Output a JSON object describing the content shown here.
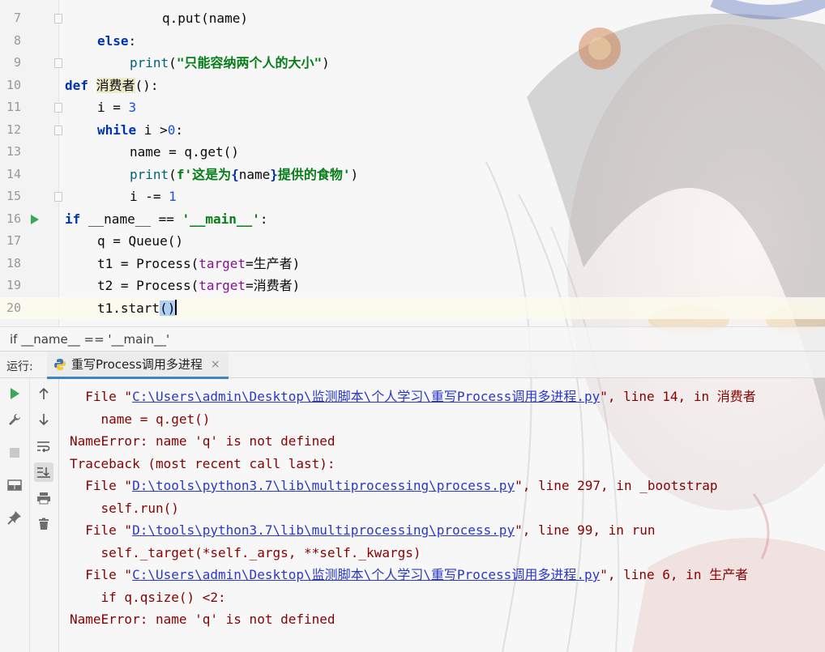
{
  "editor": {
    "lines": [
      {
        "n": "7",
        "indent": 3,
        "tokens": [
          {
            "t": "q.put(name)",
            "c": ""
          }
        ]
      },
      {
        "n": "8",
        "indent": 1,
        "tokens": [
          {
            "t": "else",
            "c": "kw"
          },
          {
            "t": ":",
            "c": ""
          }
        ]
      },
      {
        "n": "9",
        "indent": 2,
        "tokens": [
          {
            "t": "print",
            "c": "fn"
          },
          {
            "t": "(",
            "c": ""
          },
          {
            "t": "\"只能容纳两个人的大小\"",
            "c": "str"
          },
          {
            "t": ")",
            "c": ""
          }
        ]
      },
      {
        "n": "10",
        "indent": 0,
        "tokens": [
          {
            "t": "def ",
            "c": "kw"
          },
          {
            "t": "消费者",
            "c": "hl"
          },
          {
            "t": "():",
            "c": ""
          }
        ]
      },
      {
        "n": "11",
        "indent": 1,
        "tokens": [
          {
            "t": "i = ",
            "c": ""
          },
          {
            "t": "3",
            "c": "num"
          }
        ]
      },
      {
        "n": "12",
        "indent": 1,
        "tokens": [
          {
            "t": "while",
            "c": "kw"
          },
          {
            "t": " i >",
            "c": ""
          },
          {
            "t": "0",
            "c": "num"
          },
          {
            "t": ":",
            "c": ""
          }
        ]
      },
      {
        "n": "13",
        "indent": 2,
        "tokens": [
          {
            "t": "name = q.get()",
            "c": ""
          }
        ]
      },
      {
        "n": "14",
        "indent": 2,
        "tokens": [
          {
            "t": "print",
            "c": "fn"
          },
          {
            "t": "(",
            "c": ""
          },
          {
            "t": "f'这是为",
            "c": "str"
          },
          {
            "t": "{",
            "c": "kw"
          },
          {
            "t": "name",
            "c": ""
          },
          {
            "t": "}",
            "c": "kw"
          },
          {
            "t": "提供的食物'",
            "c": "str"
          },
          {
            "t": ")",
            "c": ""
          }
        ]
      },
      {
        "n": "15",
        "indent": 2,
        "tokens": [
          {
            "t": "i -= ",
            "c": ""
          },
          {
            "t": "1",
            "c": "num"
          }
        ]
      },
      {
        "n": "16",
        "indent": 0,
        "tokens": [
          {
            "t": "if ",
            "c": "kw"
          },
          {
            "t": "__name__ == ",
            "c": ""
          },
          {
            "t": "'__main__'",
            "c": "str"
          },
          {
            "t": ":",
            "c": ""
          }
        ]
      },
      {
        "n": "17",
        "indent": 1,
        "tokens": [
          {
            "t": "q = Queue()",
            "c": ""
          }
        ]
      },
      {
        "n": "18",
        "indent": 1,
        "tokens": [
          {
            "t": "t1 = Process(",
            "c": ""
          },
          {
            "t": "target",
            "c": "kwarg"
          },
          {
            "t": "=生产者)",
            "c": ""
          }
        ]
      },
      {
        "n": "19",
        "indent": 1,
        "tokens": [
          {
            "t": "t2 = Process(",
            "c": ""
          },
          {
            "t": "target",
            "c": "kwarg"
          },
          {
            "t": "=消费者)",
            "c": ""
          }
        ]
      },
      {
        "n": "20",
        "indent": 1,
        "tokens": [
          {
            "t": "t1.start",
            "c": ""
          },
          {
            "t": "()",
            "c": "caret-paren"
          }
        ]
      }
    ]
  },
  "breadcrumb": "if __name__ == '__main__'",
  "run_panel": {
    "label": "运行:",
    "tab_title": "重写Process调用多进程",
    "tab_close": "×"
  },
  "console": {
    "lines": [
      {
        "parts": [
          {
            "t": "  File \""
          },
          {
            "t": "C:\\Users\\admin\\Desktop\\监测脚本\\个人学习\\重写Process调用多进程.py",
            "link": true
          },
          {
            "t": "\", line 14, in 消费者"
          }
        ]
      },
      {
        "parts": [
          {
            "t": "    name = q.get()"
          }
        ]
      },
      {
        "parts": [
          {
            "t": "NameError: name 'q' is not defined"
          }
        ]
      },
      {
        "parts": [
          {
            "t": "Traceback (most recent call last):"
          }
        ]
      },
      {
        "parts": [
          {
            "t": "  File \""
          },
          {
            "t": "D:\\tools\\python3.7\\lib\\multiprocessing\\process.py",
            "link": true
          },
          {
            "t": "\", line 297, in _bootstrap"
          }
        ]
      },
      {
        "parts": [
          {
            "t": "    self.run()"
          }
        ]
      },
      {
        "parts": [
          {
            "t": "  File \""
          },
          {
            "t": "D:\\tools\\python3.7\\lib\\multiprocessing\\process.py",
            "link": true
          },
          {
            "t": "\", line 99, in run"
          }
        ]
      },
      {
        "parts": [
          {
            "t": "    self._target(*self._args, **self._kwargs)"
          }
        ]
      },
      {
        "parts": [
          {
            "t": "  File \""
          },
          {
            "t": "C:\\Users\\admin\\Desktop\\监测脚本\\个人学习\\重写Process调用多进程.py",
            "link": true
          },
          {
            "t": "\", line 6, in 生产者"
          }
        ]
      },
      {
        "parts": [
          {
            "t": "    if q.qsize() <2:"
          }
        ]
      },
      {
        "parts": [
          {
            "t": "NameError: name 'q' is not defined"
          }
        ]
      }
    ]
  },
  "colors": {
    "keyword": "#0033b3",
    "string": "#067d17",
    "number": "#1750eb",
    "error_text": "#870000",
    "link": "#2a38c8",
    "run_green": "#3aa857"
  }
}
